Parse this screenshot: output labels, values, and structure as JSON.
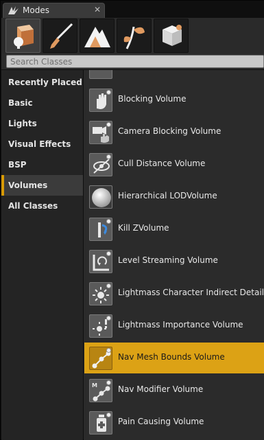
{
  "window": {
    "title": "Modes",
    "tab_icon": "modes-icon",
    "close_icon": "close-icon"
  },
  "toolbar": {
    "modes": [
      {
        "name": "place-mode",
        "icon": "box-sphere-icon",
        "active": true
      },
      {
        "name": "paint-mode",
        "icon": "paintbrush-icon",
        "active": false
      },
      {
        "name": "landscape-mode",
        "icon": "mountain-icon",
        "active": false
      },
      {
        "name": "foliage-mode",
        "icon": "leaf-icon",
        "active": false
      },
      {
        "name": "geometry-mode",
        "icon": "cube-edit-icon",
        "active": false
      }
    ]
  },
  "search": {
    "placeholder": "Search Classes",
    "value": ""
  },
  "categories": [
    {
      "label": "Recently Placed",
      "active": false
    },
    {
      "label": "Basic",
      "active": false
    },
    {
      "label": "Lights",
      "active": false
    },
    {
      "label": "Visual Effects",
      "active": false
    },
    {
      "label": "BSP",
      "active": false
    },
    {
      "label": "Volumes",
      "active": true
    },
    {
      "label": "All Classes",
      "active": false
    }
  ],
  "list": {
    "accent_color": "#dca215",
    "items": [
      {
        "label": "",
        "icon": "volume-icon",
        "selected": false
      },
      {
        "label": "Blocking Volume",
        "icon": "hand-icon",
        "selected": false
      },
      {
        "label": "Camera Blocking Volume",
        "icon": "camera-hand-icon",
        "selected": false
      },
      {
        "label": "Cull Distance Volume",
        "icon": "cull-eye-icon",
        "selected": false
      },
      {
        "label": "Hierarchical LODVolume",
        "icon": "sphere-icon",
        "selected": false
      },
      {
        "label": "Kill ZVolume",
        "icon": "kill-z-icon",
        "selected": false
      },
      {
        "label": "Level Streaming Volume",
        "icon": "level-streaming-icon",
        "selected": false
      },
      {
        "label": "Lightmass Character Indirect Detail",
        "icon": "light-sun-icon",
        "selected": false
      },
      {
        "label": "Lightmass Importance Volume",
        "icon": "light-importance-icon",
        "selected": false
      },
      {
        "label": "Nav Mesh Bounds Volume",
        "icon": "nav-mesh-icon",
        "selected": true
      },
      {
        "label": "Nav Modifier Volume",
        "icon": "nav-modifier-icon",
        "selected": false
      },
      {
        "label": "Pain Causing Volume",
        "icon": "pain-bottle-icon",
        "selected": false
      }
    ]
  }
}
